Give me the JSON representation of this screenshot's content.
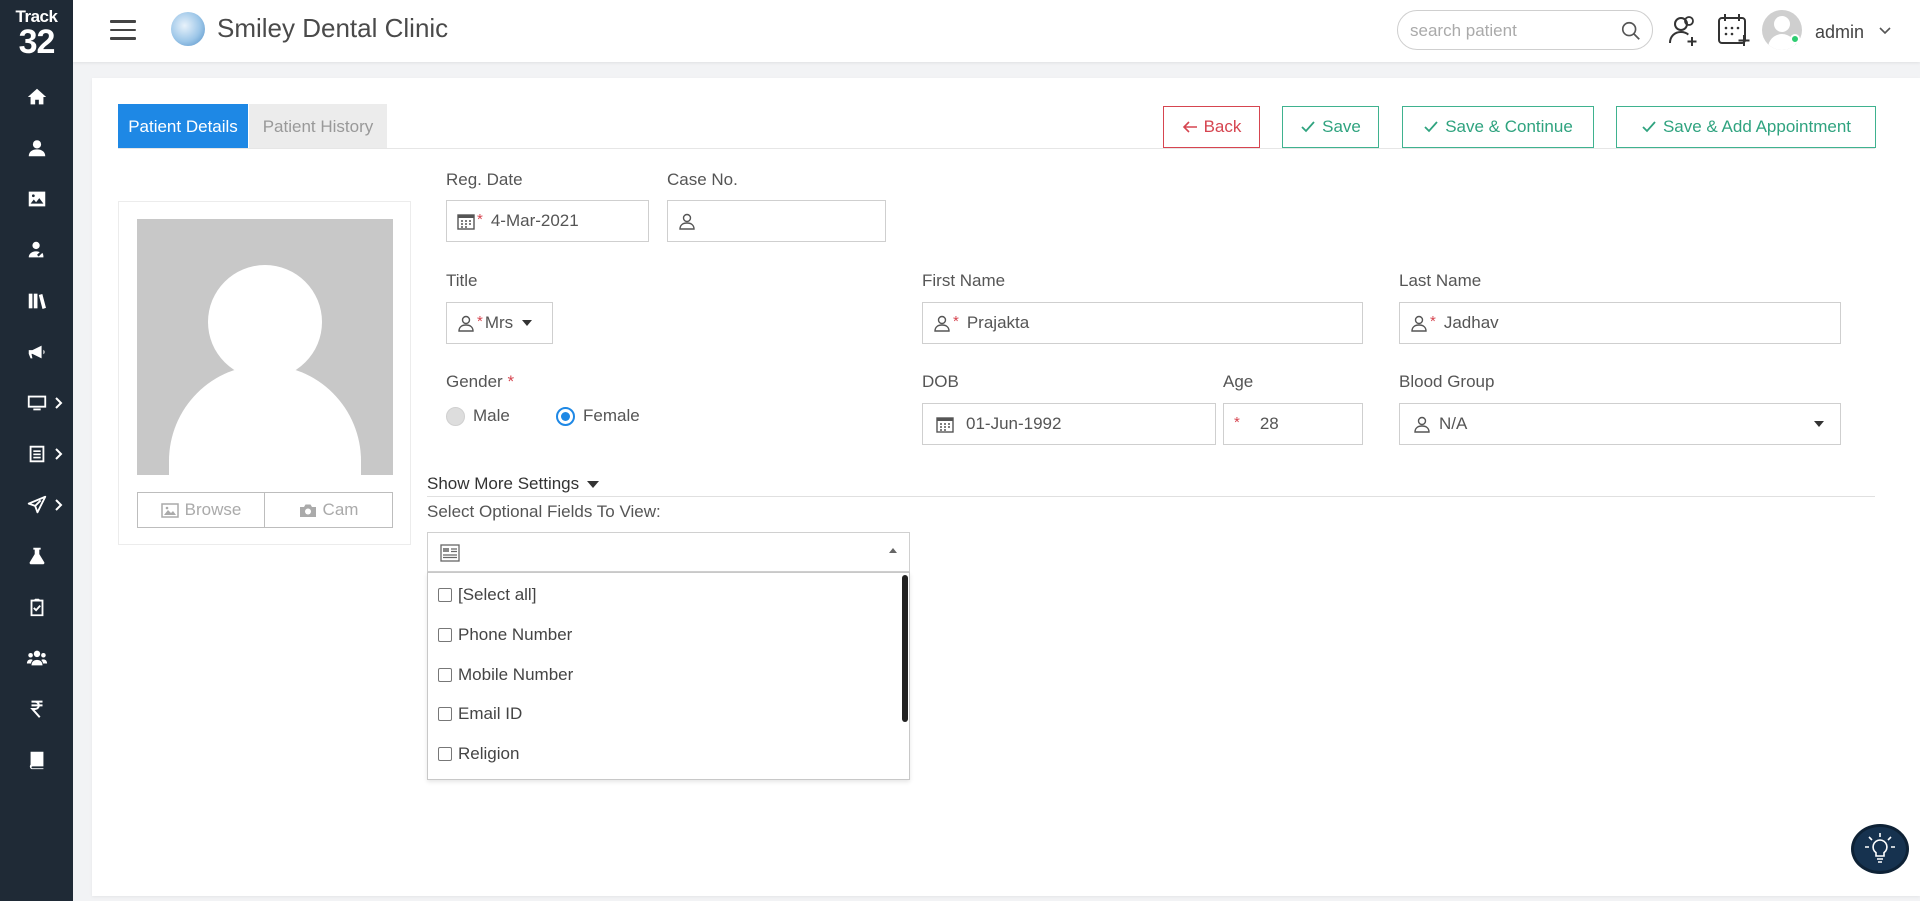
{
  "brand": {
    "line1": "Track",
    "line2": "32"
  },
  "header": {
    "clinic_name": "Smiley Dental Clinic",
    "search_placeholder": "search patient",
    "user_name": "admin"
  },
  "sidebar": {
    "items": [
      {
        "icon": "home-icon"
      },
      {
        "icon": "patient-icon"
      },
      {
        "icon": "gallery-icon"
      },
      {
        "icon": "doctor-icon"
      },
      {
        "icon": "library-icon"
      },
      {
        "icon": "megaphone-icon"
      },
      {
        "icon": "monitor-icon",
        "has_submenu": true
      },
      {
        "icon": "list-icon",
        "has_submenu": true
      },
      {
        "icon": "send-icon",
        "has_submenu": true
      },
      {
        "icon": "flask-icon"
      },
      {
        "icon": "clipboard-check-icon"
      },
      {
        "icon": "group-icon"
      },
      {
        "icon": "rupee-icon"
      },
      {
        "icon": "book-icon"
      }
    ]
  },
  "tabs": [
    {
      "label": "Patient Details",
      "active": true
    },
    {
      "label": "Patient History",
      "active": false
    }
  ],
  "actions": {
    "back": "Back",
    "save": "Save",
    "save_continue": "Save & Continue",
    "save_appointment": "Save & Add Appointment"
  },
  "photo": {
    "browse": "Browse",
    "cam": "Cam"
  },
  "form": {
    "reg_date": {
      "label": "Reg. Date",
      "value": "4-Mar-2021"
    },
    "case_no": {
      "label": "Case No.",
      "value": ""
    },
    "title": {
      "label": "Title",
      "value": "Mrs"
    },
    "first_name": {
      "label": "First Name",
      "value": "Prajakta"
    },
    "last_name": {
      "label": "Last Name",
      "value": "Jadhav"
    },
    "gender": {
      "label": "Gender",
      "required_mark": "*",
      "options": [
        "Male",
        "Female"
      ],
      "selected": "Female"
    },
    "dob": {
      "label": "DOB",
      "value": "01-Jun-1992"
    },
    "age": {
      "label": "Age",
      "value": "28"
    },
    "blood_group": {
      "label": "Blood Group",
      "value": "N/A"
    }
  },
  "more_settings": {
    "toggle": "Show More Settings",
    "optional_label": "Select Optional Fields To View:",
    "options": [
      "[Select all]",
      "Phone Number",
      "Mobile Number",
      "Email ID",
      "Religion"
    ]
  },
  "colors": {
    "sidebar_bg": "#1f2a36",
    "primary": "#1e88e5",
    "success": "#2fa37f",
    "danger": "#d64550"
  }
}
